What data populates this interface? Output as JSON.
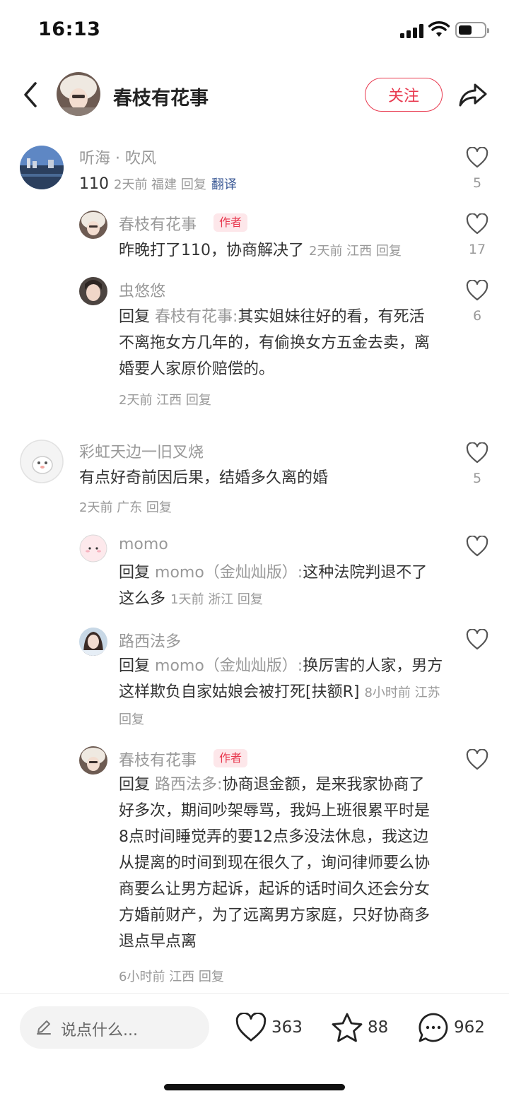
{
  "status": {
    "time": "16:13"
  },
  "header": {
    "author": "春枝有花事",
    "follow_label": "关注"
  },
  "comments": [
    {
      "user": "听海 · 吹风",
      "text": "110",
      "meta": "2天前 福建 回复",
      "translate": "翻译",
      "likes": "5"
    },
    {
      "user": "春枝有花事",
      "badge": "作者",
      "text": "昨晚打了110，协商解决了",
      "meta": "2天前 江西 回复",
      "likes": "17"
    },
    {
      "user": "虫悠悠",
      "reply_prefix": "回复",
      "reply_to": "春枝有花事:",
      "text": "其实姐妹往好的看，有死活不离拖女方几年的，有偷换女方五金去卖，离婚要人家原价赔偿的。",
      "meta": "2天前 江西 回复",
      "likes": "6"
    },
    {
      "user": "彩虹天边一旧叉烧",
      "text": "有点好奇前因后果，结婚多久离的婚",
      "meta": "2天前 广东 回复",
      "likes": "5"
    },
    {
      "user": "momo",
      "reply_prefix": "回复",
      "reply_to": "momo（金灿灿版）:",
      "text": "这种法院判退不了这么多",
      "meta": "1天前 浙江 回复",
      "likes": ""
    },
    {
      "user": "路西法多",
      "reply_prefix": "回复",
      "reply_to": "momo（金灿灿版）:",
      "text": "换厉害的人家，男方这样欺负自家姑娘会被打死[扶额R]",
      "meta": "8小时前 江苏 回复",
      "likes": ""
    },
    {
      "user": "春枝有花事",
      "badge": "作者",
      "reply_prefix": "回复",
      "reply_to": "路西法多:",
      "text": "协商退金额，是来我家协商了好多次，期间吵架辱骂，我妈上班很累平时是8点时间睡觉弄的要12点多没法休息，我这边从提离的时间到现在很久了，询问律师要么协商要么让男方起诉，起诉的话时间久还会分女方婚前财产，为了远离男方家庭，只好协商多退点早点离",
      "meta": "6小时前 江西 回复",
      "likes": ""
    }
  ],
  "bottom": {
    "placeholder": "说点什么...",
    "likes": "363",
    "stars": "88",
    "comments": "962"
  },
  "colors": {
    "accent": "#e8394f",
    "link": "#3c5a96"
  }
}
